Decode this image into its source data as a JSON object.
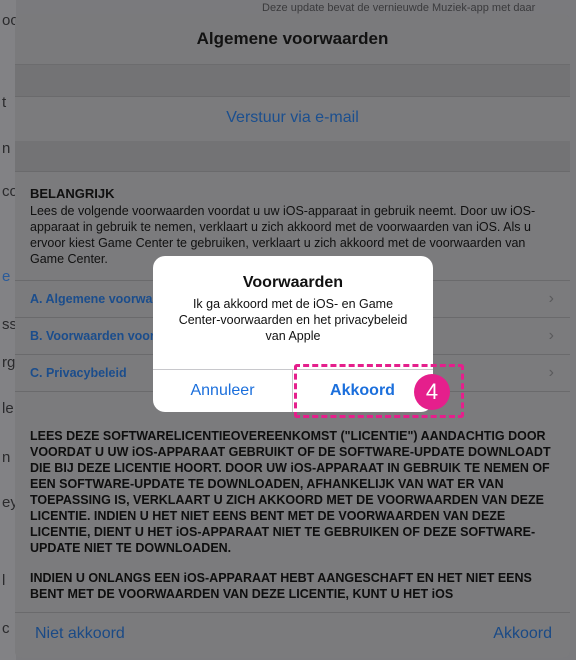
{
  "background": {
    "top_text": "Deze update bevat de vernieuwde Muziek-app met daar",
    "left_letters": [
      "oc",
      "t",
      "n",
      "co",
      "e",
      "ss",
      "rg",
      "le",
      "n",
      "ey",
      "l",
      "c"
    ]
  },
  "sheet": {
    "title": "Algemene voorwaarden",
    "email_link": "Verstuur via e-mail",
    "important_heading": "BELANGRIJK",
    "intro_text": "Lees de volgende voorwaarden voordat u uw iOS-apparaat in gebruik neemt. Door uw iOS-apparaat in gebruik te nemen, verklaart u zich akkoord met de voorwaarden van iOS. Als u ervoor kiest Game Center te gebruiken, verklaart u zich akkoord met de voorwaarden van Game Center.",
    "toc": [
      {
        "label": "A. Algemene voorwaarden"
      },
      {
        "label": "B. Voorwaarden voor Game Center"
      },
      {
        "label": "C. Privacybeleid"
      }
    ],
    "legal_paragraph_1": "LEES DEZE SOFTWARELICENTIEOVEREENKOMST (\"LICENTIE\") AANDACHTIG DOOR VOORDAT U UW iOS-APPARAAT GEBRUIKT OF DE SOFTWARE-UPDATE DOWNLOADT DIE BIJ DEZE LICENTIE HOORT. DOOR UW iOS-APPARAAT IN GEBRUIK TE NEMEN OF EEN SOFTWARE-UPDATE TE DOWNLOADEN, AFHANKELIJK VAN WAT ER VAN TOEPASSING IS, VERKLAART U ZICH AKKOORD MET DE VOORWAARDEN VAN DEZE LICENTIE. INDIEN U HET NIET EENS BENT MET DE VOORWAARDEN VAN DEZE LICENTIE, DIENT U HET iOS-APPARAAT NIET TE GEBRUIKEN OF DEZE SOFTWARE-UPDATE NIET TE DOWNLOADEN.",
    "legal_paragraph_2": "INDIEN U ONLANGS EEN iOS-APPARAAT HEBT AANGESCHAFT EN HET NIET EENS BENT MET DE VOORWAARDEN VAN DEZE LICENTIE, KUNT U HET iOS",
    "footer_left": "Niet akkoord",
    "footer_right": "Akkoord"
  },
  "dialog": {
    "title": "Voorwaarden",
    "message": "Ik ga akkoord met de iOS- en Game Center-voorwaarden en het privacybeleid van Apple",
    "cancel_label": "Annuleer",
    "confirm_label": "Akkoord"
  },
  "annotation": {
    "step_number": "4",
    "color": "#e51f8c"
  }
}
